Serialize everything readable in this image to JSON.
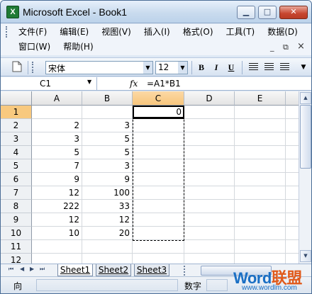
{
  "window": {
    "title": "Microsoft Excel - Book1",
    "min_glyph": "▁",
    "max_glyph": "□",
    "close_glyph": "✕",
    "app_icon": "X"
  },
  "menu": {
    "row1": [
      "文件(F)",
      "编辑(E)",
      "视图(V)",
      "插入(I)",
      "格式(O)",
      "工具(T)",
      "数据(D)"
    ],
    "row2": [
      "窗口(W)",
      "帮助(H)"
    ],
    "doc_min_glyph": "_",
    "doc_restore_glyph": "⧉",
    "doc_close_glyph": "×"
  },
  "toolbar": {
    "font_name": "宋体",
    "font_size": "12",
    "bold_label": "B",
    "italic_label": "I",
    "underline_label": "U",
    "dropdown_glyph": "▼"
  },
  "formula_bar": {
    "name_box": "C1",
    "fx_label": "fx",
    "formula": "=A1*B1"
  },
  "sheet": {
    "columns": [
      "A",
      "B",
      "C",
      "D",
      "E"
    ],
    "rows": [
      "1",
      "2",
      "3",
      "4",
      "5",
      "6",
      "7",
      "8",
      "9",
      "10",
      "11",
      "12"
    ],
    "cells": [
      {
        "ref": "C1",
        "value": "0"
      },
      {
        "ref": "A2",
        "value": "2"
      },
      {
        "ref": "B2",
        "value": "3"
      },
      {
        "ref": "A3",
        "value": "3"
      },
      {
        "ref": "B3",
        "value": "5"
      },
      {
        "ref": "A4",
        "value": "5"
      },
      {
        "ref": "B4",
        "value": "5"
      },
      {
        "ref": "A5",
        "value": "7"
      },
      {
        "ref": "B5",
        "value": "3"
      },
      {
        "ref": "A6",
        "value": "9"
      },
      {
        "ref": "B6",
        "value": "9"
      },
      {
        "ref": "A7",
        "value": "12"
      },
      {
        "ref": "B7",
        "value": "100"
      },
      {
        "ref": "A8",
        "value": "222"
      },
      {
        "ref": "B8",
        "value": "33"
      },
      {
        "ref": "A9",
        "value": "12"
      },
      {
        "ref": "B9",
        "value": "12"
      },
      {
        "ref": "A10",
        "value": "10"
      },
      {
        "ref": "B10",
        "value": "20"
      }
    ],
    "active_cell": "C1",
    "copy_range": "C1:C10"
  },
  "tabs": {
    "nav": [
      "⏮",
      "◀",
      "▶",
      "⏭"
    ],
    "sheets": [
      "Sheet1",
      "Sheet2",
      "Sheet3"
    ],
    "active": "Sheet1"
  },
  "status": {
    "ready": "向",
    "mode": "数字"
  },
  "watermark": {
    "logo_a": "Word",
    "logo_b": "联盟",
    "url": "www.wordlm.com"
  },
  "colors": {
    "title_gradient_top": "#e7f0fb",
    "active_header": "#f7c67c",
    "watermark_blue": "#1a6fc4",
    "watermark_orange": "#e05a1b"
  }
}
